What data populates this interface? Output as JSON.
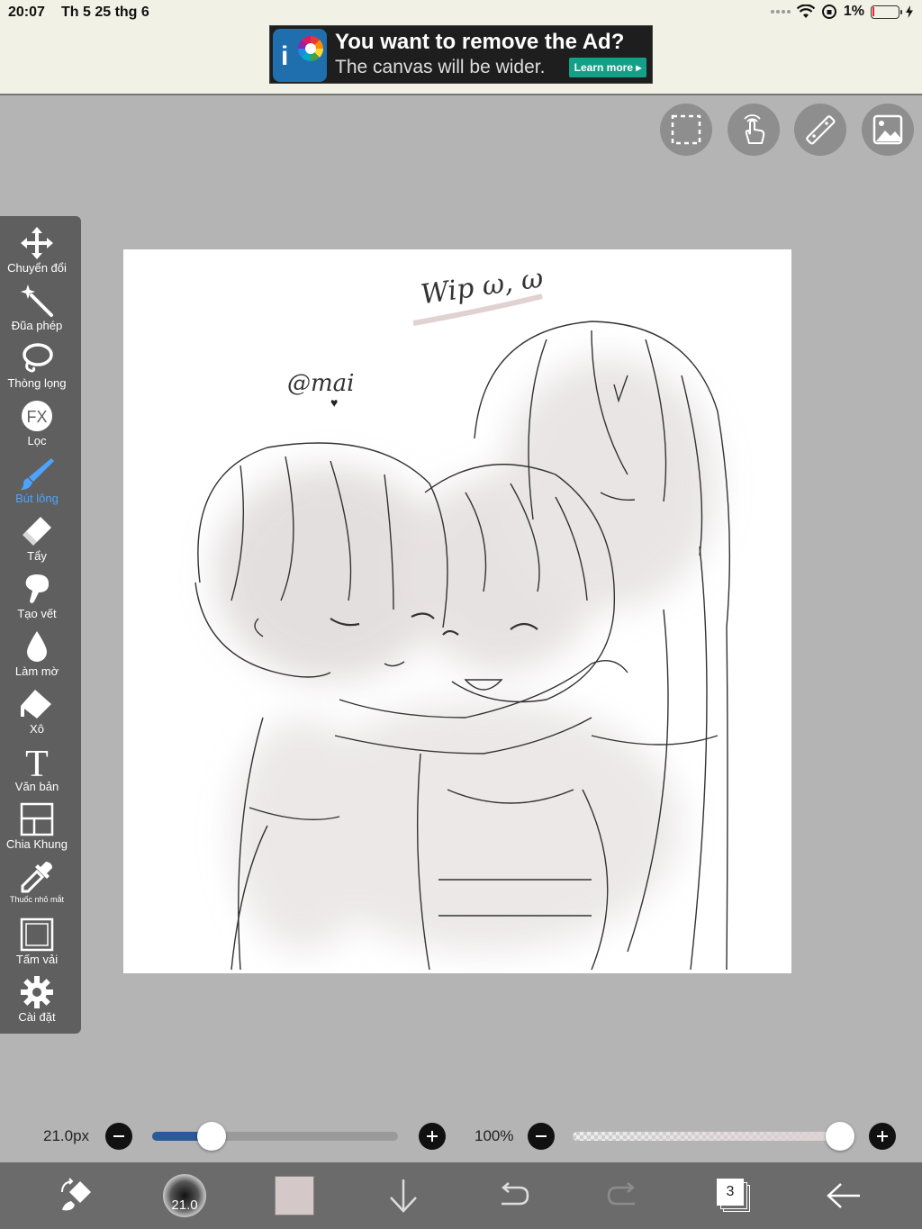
{
  "status_bar": {
    "time": "20:07",
    "date": "Th 5 25 thg 6",
    "battery_percent": "1%"
  },
  "ad": {
    "headline": "You want to remove the Ad?",
    "subline": "The canvas will be wider.",
    "cta": "Learn more ▸"
  },
  "top_tools": [
    {
      "icon": "selection-icon"
    },
    {
      "icon": "hand-touch-icon"
    },
    {
      "icon": "ruler-icon"
    },
    {
      "icon": "material-image-icon"
    }
  ],
  "toolbar": {
    "items": [
      {
        "label": "Chuyển đổi",
        "icon": "move-arrows-icon"
      },
      {
        "label": "Đũa phép",
        "icon": "magic-wand-icon"
      },
      {
        "label": "Thòng lọng",
        "icon": "lasso-icon"
      },
      {
        "label": "Lọc",
        "icon": "fx-filter-icon"
      },
      {
        "label": "Bút lông",
        "icon": "brush-icon",
        "active": true
      },
      {
        "label": "Tẩy",
        "icon": "eraser-icon"
      },
      {
        "label": "Tạo vết",
        "icon": "smudge-icon"
      },
      {
        "label": "Làm mờ",
        "icon": "blur-drop-icon"
      },
      {
        "label": "Xô",
        "icon": "bucket-icon"
      },
      {
        "label": "Văn bản",
        "icon": "text-icon"
      },
      {
        "label": "Chia Khung",
        "icon": "frame-divider-icon"
      },
      {
        "label": "Thuốc nhỏ mắt",
        "icon": "eyedropper-icon"
      },
      {
        "label": "Tấm vải",
        "icon": "canvas-icon"
      },
      {
        "label": "Cài đặt",
        "icon": "gear-icon"
      }
    ]
  },
  "canvas": {
    "handwriting_top": "Wip ω, ω",
    "handwriting_signature": "@mai"
  },
  "brush_size": {
    "label": "21.0px",
    "level": 0.24
  },
  "opacity": {
    "label": "100%",
    "level": 1.0
  },
  "bottom_bar": {
    "brush_preview_value": "21.0",
    "current_color": "#d4c8c8",
    "layer_count": "3",
    "accent_color": "#4ea3ff",
    "slider_fill_color": "#2a5a99"
  }
}
